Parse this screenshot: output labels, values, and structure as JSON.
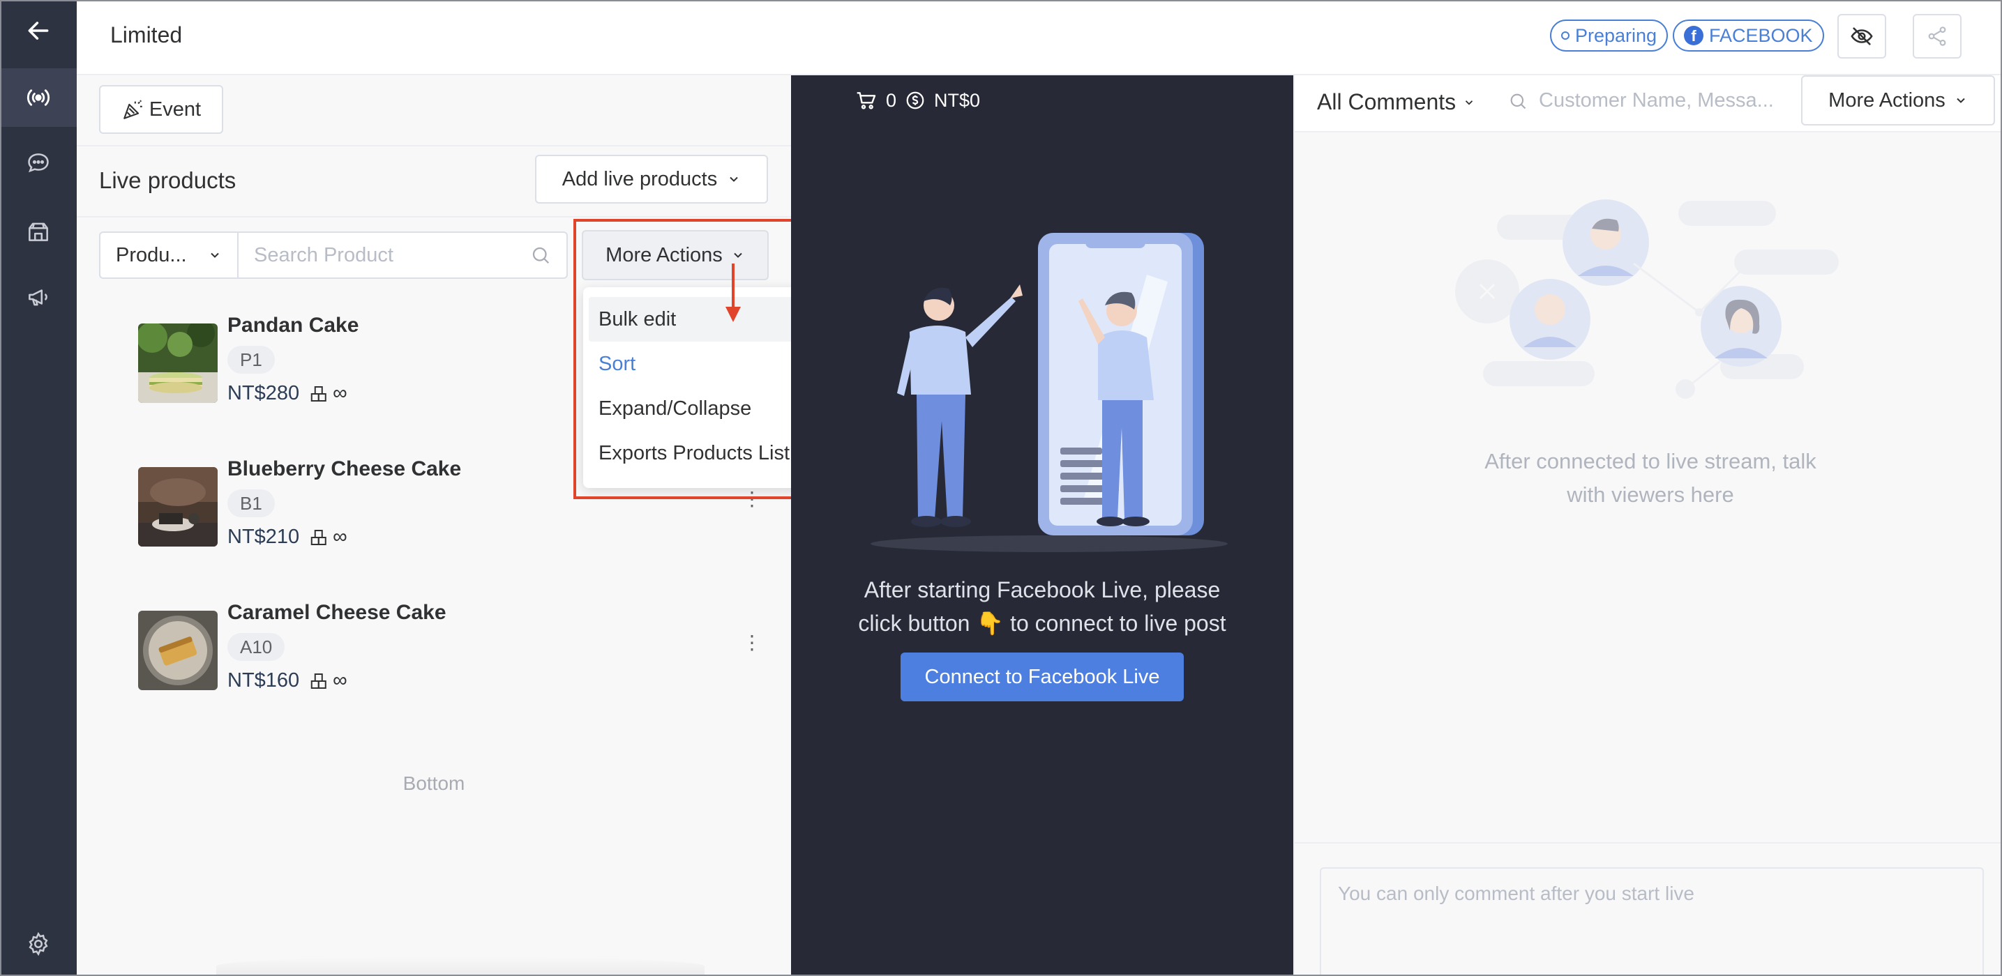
{
  "header": {
    "title": "Limited",
    "status_badge": "Preparing",
    "platform_badge": "FACEBOOK"
  },
  "nav": {
    "icons": [
      "back-arrow-icon",
      "live-broadcast-icon",
      "chat-icon",
      "store-analytics-icon",
      "megaphone-icon",
      "gear-icon"
    ]
  },
  "left_panel": {
    "event_button": "Event",
    "title": "Live products",
    "add_live_products": "Add live products",
    "filter_select": "Produ...",
    "search_placeholder": "Search Product",
    "more_actions": "More Actions",
    "dropdown": {
      "items": [
        {
          "label": "Bulk edit",
          "submenu": false
        },
        {
          "label": "Sort",
          "submenu": true
        },
        {
          "label": "Expand/Collapse",
          "submenu": true
        },
        {
          "label": "Exports Products List",
          "submenu": false
        }
      ]
    },
    "products": [
      {
        "name": "Pandan Cake",
        "code": "P1",
        "price": "NT$280",
        "stock": "∞"
      },
      {
        "name": "Blueberry Cheese Cake",
        "code": "B1",
        "price": "NT$210",
        "stock": "∞"
      },
      {
        "name": "Caramel Cheese Cake",
        "code": "A10",
        "price": "NT$160",
        "stock": "∞"
      }
    ],
    "bottom_text": "Bottom"
  },
  "center_panel": {
    "cart_count": "0",
    "cart_total": "NT$0",
    "message_line1": "After starting Facebook Live, please",
    "message_line2a": "click button",
    "message_emoji": "👇",
    "message_line2b": "to connect to live post",
    "connect_button": "Connect to Facebook Live"
  },
  "right_panel": {
    "comments_filter": "All Comments",
    "search_placeholder": "Customer Name, Messa...",
    "more_actions": "More Actions",
    "empty_message_line1": "After connected to live stream, talk",
    "empty_message_line2": "with viewers here",
    "comment_placeholder": "You can only comment after you start live"
  },
  "colors": {
    "accent": "#4a7fd6",
    "rail": "#2e3342",
    "center_bg": "#272a36",
    "highlight": "#e0442a",
    "connect_button": "#4c7fe0"
  }
}
